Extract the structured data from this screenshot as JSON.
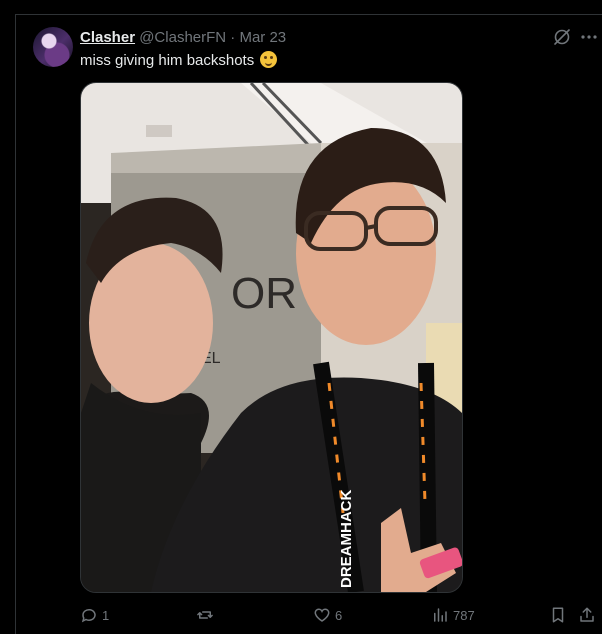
{
  "post": {
    "display_name": "Clasher",
    "handle": "@ClasherFN",
    "separator": "·",
    "date": "Mar 23",
    "text": "miss giving him backshots",
    "emoji": "face-holding-back-tears-emoji",
    "image_text": {
      "sign_letters": "OR",
      "sign_letter_2": "EL",
      "lanyard_text": "DREAMHACK"
    }
  },
  "actions": {
    "replies": "1",
    "reposts": "",
    "likes": "6",
    "views": "787"
  },
  "icons": {
    "grok": "grok-icon",
    "more": "more-icon",
    "reply": "reply-icon",
    "repost": "repost-icon",
    "like": "heart-icon",
    "views": "views-icon",
    "bookmark": "bookmark-icon",
    "share": "share-icon"
  },
  "colors": {
    "background": "#000000",
    "text_primary": "#e7e9ea",
    "text_secondary": "#71767b",
    "border": "#2f3336"
  }
}
